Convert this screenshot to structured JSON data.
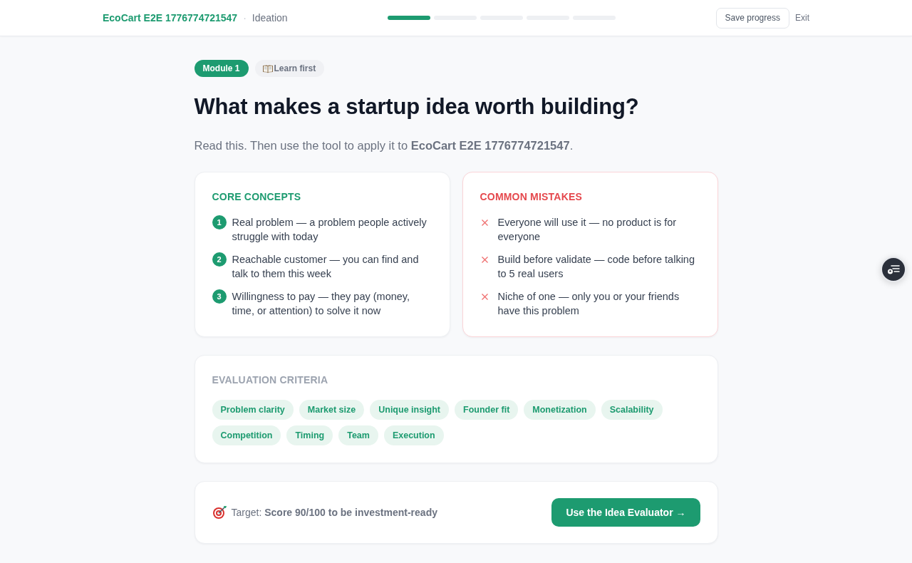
{
  "header": {
    "project": "EcoCart E2E 1776774721547",
    "separator": "·",
    "stage": "Ideation",
    "progress_steps": [
      {
        "complete": true
      },
      {
        "complete": false
      },
      {
        "complete": false
      },
      {
        "complete": false
      },
      {
        "complete": false
      }
    ],
    "save_button": "Save progress",
    "exit_link": "Exit"
  },
  "lesson": {
    "module_badge": "Module 1",
    "learn_badge": "Learn first",
    "title": "What makes a startup idea worth building?",
    "intro": "Read this. Then use the tool to apply it to **EcoCart E2E 1776774721547**."
  },
  "core_concepts": {
    "heading": "CORE CONCEPTS",
    "items": [
      {
        "number": "1",
        "text": "Real problem — a problem people actively struggle with today"
      },
      {
        "number": "2",
        "text": "Reachable customer — you can find and talk to them this week"
      },
      {
        "number": "3",
        "text": "Willingness to pay — they pay (money, time, or attention) to solve it now"
      }
    ]
  },
  "common_mistakes": {
    "heading": "COMMON MISTAKES",
    "items": [
      "Everyone will use it — no product is for everyone",
      "Build before validate — code before talking to 5 real users",
      "Niche of one — only you or your friends have this problem"
    ]
  },
  "evaluation_criteria": {
    "heading": "EVALUATION CRITERIA",
    "tags": [
      "Problem clarity",
      "Market size",
      "Unique insight",
      "Founder fit",
      "Monetization",
      "Scalability",
      "Competition",
      "Timing",
      "Team",
      "Execution"
    ]
  },
  "target": {
    "text": "Target: **Score 90/100 to be investment-ready**",
    "button": "Use the Idea Evaluator →"
  }
}
